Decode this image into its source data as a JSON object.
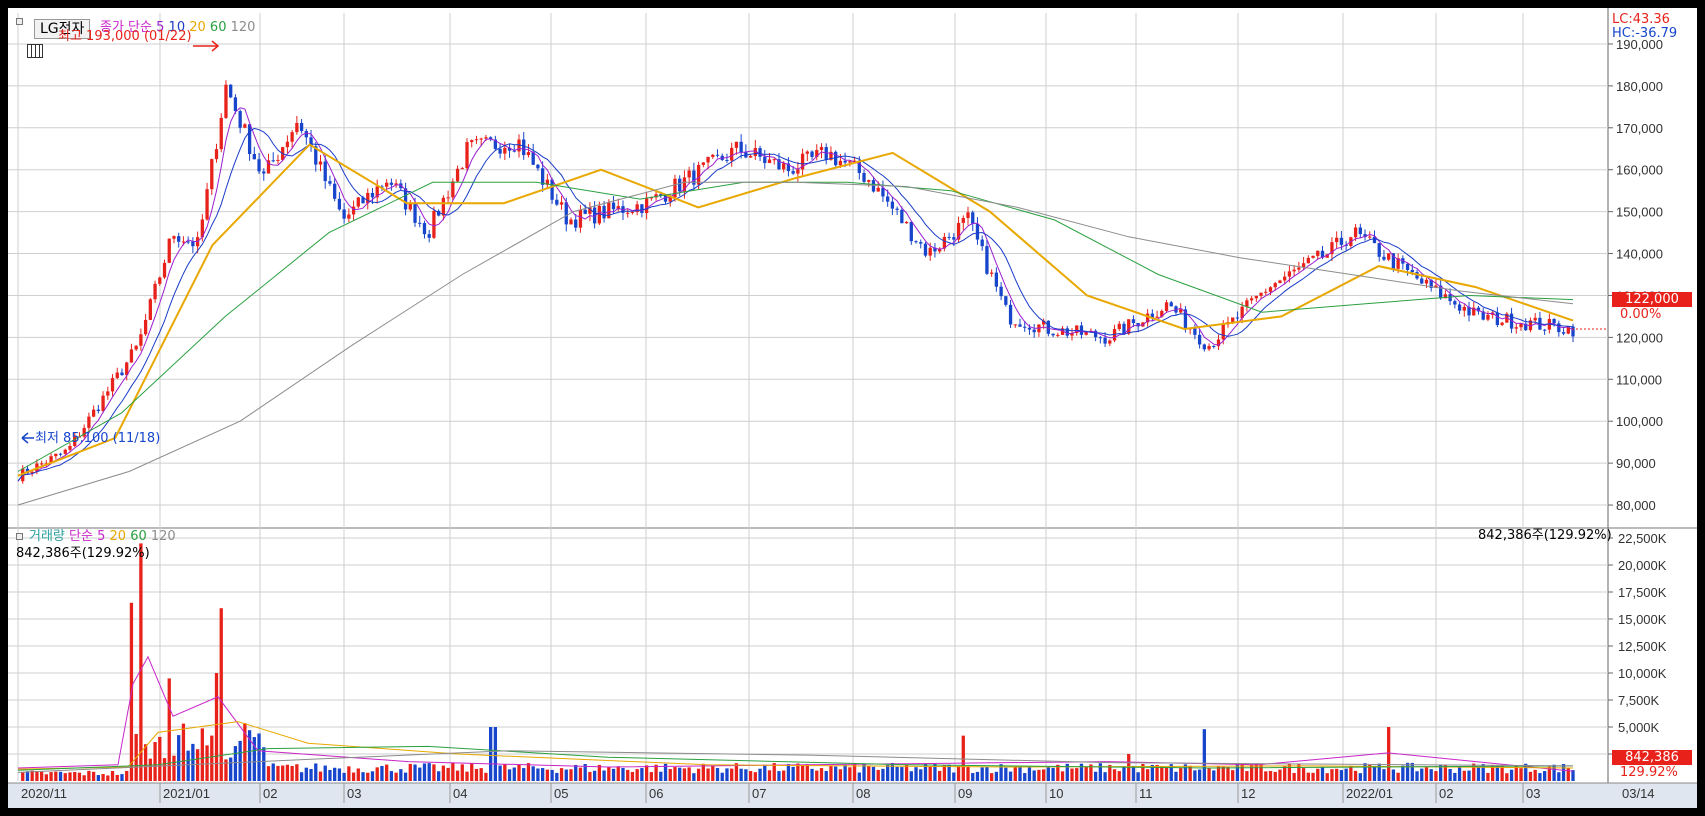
{
  "symbol": "LG전자",
  "price_legend": {
    "title": "종가 단순",
    "periods": [
      {
        "label": "5",
        "color": "#9b1fd0"
      },
      {
        "label": "10",
        "color": "#1a3cc8"
      },
      {
        "label": "20",
        "color": "#e8a800"
      },
      {
        "label": "60",
        "color": "#2aa040"
      },
      {
        "label": "120",
        "color": "#8c8c8c"
      }
    ]
  },
  "volume_legend": {
    "prefix": "거래량",
    "title": "단순",
    "periods": [
      {
        "label": "5",
        "color": "#c826c8"
      },
      {
        "label": "20",
        "color": "#e8a800"
      },
      {
        "label": "60",
        "color": "#2aa040"
      },
      {
        "label": "120",
        "color": "#8c8c8c"
      }
    ]
  },
  "annotations": {
    "high": "최고 193,000 (01/22)",
    "low": "최저 85,100 (11/18)",
    "lc": "LC:43.36",
    "hc": "HC:-36.79",
    "current_price": "122,000",
    "current_change": "0.00%",
    "volume_info": "842,386주(129.92%)",
    "volume_current": "842,386",
    "volume_change": "129.92%"
  },
  "colors": {
    "up": "#e8221b",
    "down": "#1745cc",
    "grid": "#cfcfcf",
    "axis_text": "#333333"
  },
  "x_axis_labels": [
    "2020/11",
    "2021/01",
    "02",
    "03",
    "04",
    "05",
    "06",
    "07",
    "08",
    "09",
    "10",
    "11",
    "12",
    "2022/01",
    "02",
    "03"
  ],
  "x_axis_end_label": "03/14",
  "chart_data": [
    {
      "type": "candlestick",
      "title": "LG전자",
      "x": [
        "2020/11",
        "2020/12",
        "2021/01",
        "02",
        "03",
        "04",
        "05",
        "06",
        "07",
        "08",
        "09",
        "10",
        "11",
        "12",
        "2022/01",
        "02",
        "03"
      ],
      "price_points": [
        {
          "date": "2020/11",
          "close": 87000
        },
        {
          "date": "2020/12 early",
          "close": 93000
        },
        {
          "date": "2020/12 mid",
          "close": 118000
        },
        {
          "date": "2020/12 late",
          "close": 145000
        },
        {
          "date": "2021/01 mid",
          "close": 142000
        },
        {
          "date": "2021/01/22",
          "close": 180000
        },
        {
          "date": "2021/02 early",
          "close": 158000
        },
        {
          "date": "2021/02 mid",
          "close": 172000
        },
        {
          "date": "2021/03 early",
          "close": 148000
        },
        {
          "date": "2021/03 late",
          "close": 158000
        },
        {
          "date": "2021/04 early",
          "close": 145000
        },
        {
          "date": "2021/04 mid",
          "close": 165000
        },
        {
          "date": "2021/04 late",
          "close": 167000
        },
        {
          "date": "2021/05",
          "close": 148000
        },
        {
          "date": "2021/06",
          "close": 152000
        },
        {
          "date": "2021/07 early",
          "close": 165000
        },
        {
          "date": "2021/07 mid",
          "close": 160000
        },
        {
          "date": "2021/08 early",
          "close": 164000
        },
        {
          "date": "2021/08 mid",
          "close": 158000
        },
        {
          "date": "2021/09 early",
          "close": 140000
        },
        {
          "date": "2021/09 mid",
          "close": 148000
        },
        {
          "date": "2021/10 early",
          "close": 125000
        },
        {
          "date": "2021/10 mid",
          "close": 122000
        },
        {
          "date": "2021/11",
          "close": 120000
        },
        {
          "date": "2021/12 early",
          "close": 128000
        },
        {
          "date": "2021/12 mid",
          "close": 118000
        },
        {
          "date": "2021/12 late",
          "close": 132000
        },
        {
          "date": "2022/01 early",
          "close": 140000
        },
        {
          "date": "2022/01 mid",
          "close": 145000
        },
        {
          "date": "2022/02 early",
          "close": 132000
        },
        {
          "date": "2022/02 mid",
          "close": 125000
        },
        {
          "date": "2022/03",
          "close": 122000
        }
      ],
      "moving_averages": [
        {
          "name": "20",
          "color": "#e8a800",
          "values": [
            {
              "date": "2020/11",
              "value": 87000
            },
            {
              "date": "2020/12",
              "value": 96000
            },
            {
              "date": "2021/01",
              "value": 142000
            },
            {
              "date": "2021/02",
              "value": 166000
            },
            {
              "date": "2021/03",
              "value": 152000
            },
            {
              "date": "2021/04",
              "value": 152000
            },
            {
              "date": "2021/05",
              "value": 160000
            },
            {
              "date": "2021/06",
              "value": 151000
            },
            {
              "date": "2021/07",
              "value": 158000
            },
            {
              "date": "2021/08",
              "value": 164000
            },
            {
              "date": "2021/09",
              "value": 150000
            },
            {
              "date": "2021/10",
              "value": 130000
            },
            {
              "date": "2021/11",
              "value": 122000
            },
            {
              "date": "2021/12",
              "value": 125000
            },
            {
              "date": "2022/01",
              "value": 137000
            },
            {
              "date": "2022/02",
              "value": 132000
            },
            {
              "date": "2022/03",
              "value": 124000
            }
          ]
        },
        {
          "name": "60",
          "color": "#2aa040",
          "values": [
            {
              "date": "2020/11",
              "value": 88000
            },
            {
              "date": "2021/01",
              "value": 102000
            },
            {
              "date": "2021/02",
              "value": 125000
            },
            {
              "date": "2021/03",
              "value": 145000
            },
            {
              "date": "2021/04",
              "value": 157000
            },
            {
              "date": "2021/05",
              "value": 157000
            },
            {
              "date": "2021/06",
              "value": 153000
            },
            {
              "date": "2021/07",
              "value": 157000
            },
            {
              "date": "2021/08",
              "value": 157000
            },
            {
              "date": "2021/09",
              "value": 155000
            },
            {
              "date": "2021/10",
              "value": 148000
            },
            {
              "date": "2021/11",
              "value": 135000
            },
            {
              "date": "2021/12",
              "value": 126000
            },
            {
              "date": "2022/01",
              "value": 128000
            },
            {
              "date": "2022/02",
              "value": 130000
            },
            {
              "date": "2022/03",
              "value": 129000
            }
          ]
        },
        {
          "name": "120",
          "color": "#8c8c8c",
          "values": [
            {
              "date": "2020/11",
              "value": 80000
            },
            {
              "date": "2021/01",
              "value": 88000
            },
            {
              "date": "2021/02",
              "value": 100000
            },
            {
              "date": "2021/04",
              "value": 118000
            },
            {
              "date": "2021/05",
              "value": 135000
            },
            {
              "date": "2021/06",
              "value": 150000
            },
            {
              "date": "2021/07",
              "value": 157000
            },
            {
              "date": "2021/08",
              "value": 157000
            },
            {
              "date": "2021/09",
              "value": 156000
            },
            {
              "date": "2021/10",
              "value": 151000
            },
            {
              "date": "2021/11",
              "value": 144000
            },
            {
              "date": "2021/12",
              "value": 139000
            },
            {
              "date": "2022/01",
              "value": 135000
            },
            {
              "date": "2022/02",
              "value": 131000
            },
            {
              "date": "2022/03",
              "value": 128000
            }
          ]
        }
      ],
      "y_ticks": [
        "190,000",
        "180,000",
        "170,000",
        "160,000",
        "150,000",
        "140,000",
        "130,000",
        "120,000",
        "110,000",
        "100,000",
        "90,000",
        "80,000"
      ],
      "ylim": [
        75000,
        195000
      ],
      "grid": true
    },
    {
      "type": "bar",
      "title": "거래량",
      "y_ticks": [
        "22,500K",
        "20,000K",
        "17,500K",
        "15,000K",
        "12,500K",
        "10,000K",
        "7,500K",
        "5,000K",
        "2,500K"
      ],
      "ylim": [
        0,
        22500
      ],
      "unit": "K shares",
      "spikes": [
        {
          "date": "2020/12 mid",
          "value": 16500
        },
        {
          "date": "2020/12 mid+1",
          "value": 22000
        },
        {
          "date": "2020/12 late",
          "value": 9500
        },
        {
          "date": "2021/01/21",
          "value": 10000
        },
        {
          "date": "2021/01/22",
          "value": 16000
        },
        {
          "date": "2021/04",
          "value": 5000
        },
        {
          "date": "2021/09",
          "value": 4200
        },
        {
          "date": "2021/11",
          "value": 2500
        },
        {
          "date": "2021/12",
          "value": 4800
        },
        {
          "date": "2022/01",
          "value": 5000
        }
      ],
      "baseline_typical": 1200,
      "current": 842
    }
  ]
}
